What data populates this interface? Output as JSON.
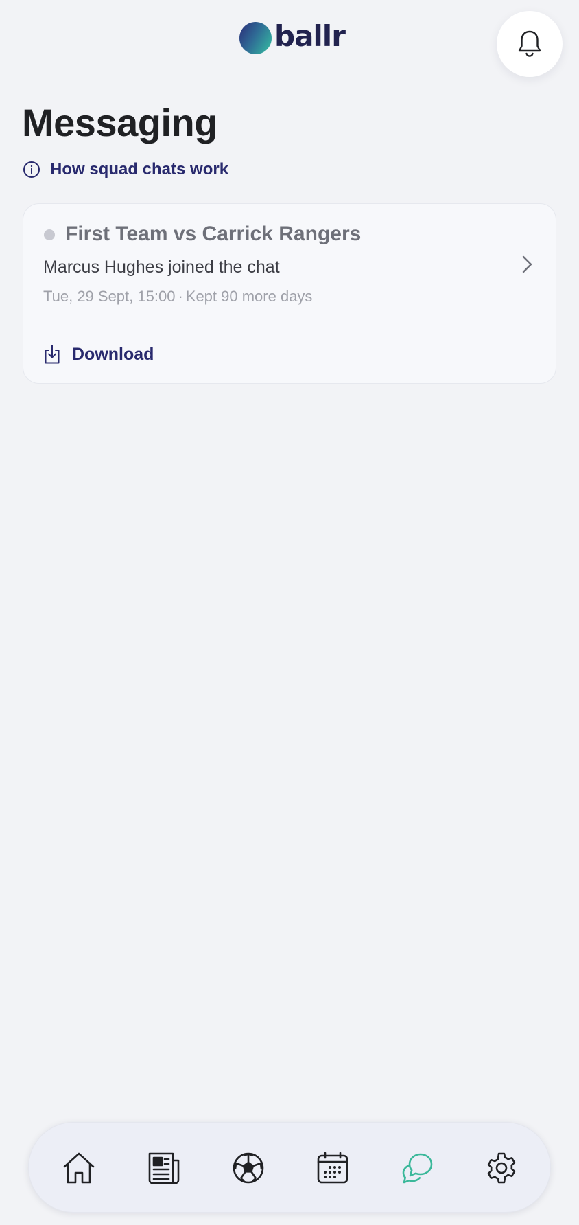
{
  "header": {
    "logo_text": "ballr",
    "logo_icon": "ballr-logo-mark",
    "notifications_icon": "bell-icon"
  },
  "page": {
    "title": "Messaging",
    "info_link_label": "How squad chats work",
    "info_icon": "info-circle-icon"
  },
  "chats": [
    {
      "title": "First Team vs Carrick Rangers",
      "last_message": "Marcus Hughes joined the chat",
      "date": "Tue, 29 Sept, 15:00",
      "separator": "·",
      "retention": "Kept 90 more days",
      "download_label": "Download",
      "download_icon": "download-icon",
      "chevron_icon": "chevron-right-icon"
    }
  ],
  "bottom_nav": {
    "items": [
      {
        "id": "home",
        "icon": "home-icon"
      },
      {
        "id": "news",
        "icon": "newspaper-icon"
      },
      {
        "id": "matches",
        "icon": "football-icon"
      },
      {
        "id": "calendar",
        "icon": "calendar-icon"
      },
      {
        "id": "messaging",
        "icon": "chat-bubbles-icon",
        "active": true
      },
      {
        "id": "settings",
        "icon": "gear-icon"
      }
    ],
    "active_color": "#3bb89a",
    "inactive_color": "#202124"
  },
  "colors": {
    "accent_navy": "#292a6e",
    "background": "#f2f3f6"
  }
}
